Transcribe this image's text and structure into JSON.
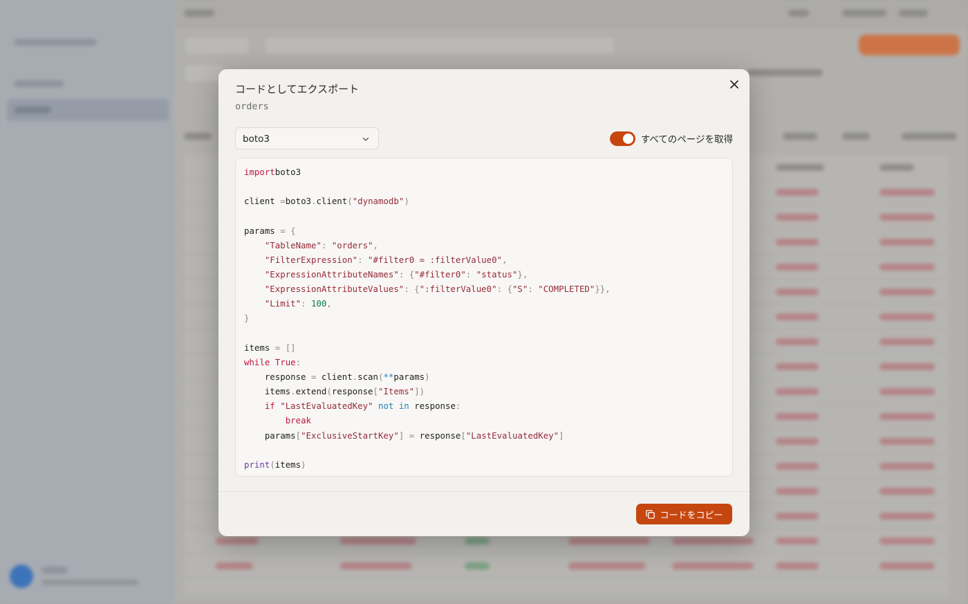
{
  "modal": {
    "title": "コードとしてエクスポート",
    "subtitle": "orders",
    "language_select": {
      "selected": "boto3"
    },
    "fetch_all_pages": {
      "label": "すべてのページを取得",
      "enabled": true
    },
    "copy_button_label": "コードをコピー",
    "accent_color": "#c6460f"
  },
  "code_lines": [
    [
      [
        "kw",
        "import"
      ],
      [
        "",
        "boto3"
      ]
    ],
    [],
    [
      [
        "",
        "client "
      ],
      [
        "op",
        "="
      ],
      [
        "",
        "boto3"
      ],
      [
        "op",
        "."
      ],
      [
        "",
        "client"
      ],
      [
        "op",
        "("
      ],
      [
        "str",
        "\"dynamodb\""
      ],
      [
        "op",
        ")"
      ]
    ],
    [],
    [
      [
        "",
        "params "
      ],
      [
        "op",
        "="
      ],
      [
        "op",
        " {"
      ]
    ],
    [
      [
        "",
        "    "
      ],
      [
        "str",
        "\"TableName\""
      ],
      [
        "op",
        ": "
      ],
      [
        "str",
        "\"orders\""
      ],
      [
        "op",
        ","
      ]
    ],
    [
      [
        "",
        "    "
      ],
      [
        "str",
        "\"FilterExpression\""
      ],
      [
        "op",
        ": "
      ],
      [
        "str",
        "\"#filter0 = :filterValue0\""
      ],
      [
        "op",
        ","
      ]
    ],
    [
      [
        "",
        "    "
      ],
      [
        "str",
        "\"ExpressionAttributeNames\""
      ],
      [
        "op",
        ": {"
      ],
      [
        "str",
        "\"#filter0\""
      ],
      [
        "op",
        ": "
      ],
      [
        "str",
        "\"status\""
      ],
      [
        "op",
        "},"
      ]
    ],
    [
      [
        "",
        "    "
      ],
      [
        "str",
        "\"ExpressionAttributeValues\""
      ],
      [
        "op",
        ": {"
      ],
      [
        "str",
        "\":filterValue0\""
      ],
      [
        "op",
        ": {"
      ],
      [
        "str",
        "\"S\""
      ],
      [
        "op",
        ": "
      ],
      [
        "str",
        "\"COMPLETED\""
      ],
      [
        "op",
        "}},"
      ]
    ],
    [
      [
        "",
        "    "
      ],
      [
        "str",
        "\"Limit\""
      ],
      [
        "op",
        ": "
      ],
      [
        "num",
        "100"
      ],
      [
        "op",
        ","
      ]
    ],
    [
      [
        "op",
        "}"
      ]
    ],
    [],
    [
      [
        "",
        "items "
      ],
      [
        "op",
        "="
      ],
      [
        "op",
        " []"
      ]
    ],
    [
      [
        "kw",
        "while"
      ],
      [
        "",
        " "
      ],
      [
        "kw",
        "True"
      ],
      [
        "op",
        ":"
      ]
    ],
    [
      [
        "",
        "    response "
      ],
      [
        "op",
        "="
      ],
      [
        "",
        " client"
      ],
      [
        "op",
        "."
      ],
      [
        "",
        "scan"
      ],
      [
        "op",
        "("
      ],
      [
        "kw2",
        "**"
      ],
      [
        "",
        "params"
      ],
      [
        "op",
        ")"
      ]
    ],
    [
      [
        "",
        "    items"
      ],
      [
        "op",
        "."
      ],
      [
        "",
        "extend"
      ],
      [
        "op",
        "("
      ],
      [
        "",
        "response"
      ],
      [
        "op",
        "["
      ],
      [
        "str",
        "\"Items\""
      ],
      [
        "op",
        "])"
      ]
    ],
    [
      [
        "",
        "    "
      ],
      [
        "kw",
        "if"
      ],
      [
        "",
        " "
      ],
      [
        "str",
        "\"LastEvaluatedKey\""
      ],
      [
        "",
        " "
      ],
      [
        "kw2",
        "not"
      ],
      [
        "",
        " "
      ],
      [
        "kw2",
        "in"
      ],
      [
        "",
        " response"
      ],
      [
        "op",
        ":"
      ]
    ],
    [
      [
        "",
        "        "
      ],
      [
        "kw",
        "break"
      ]
    ],
    [
      [
        "",
        "    params"
      ],
      [
        "op",
        "["
      ],
      [
        "str",
        "\"ExclusiveStartKey\""
      ],
      [
        "op",
        "]"
      ],
      [
        "",
        " "
      ],
      [
        "op",
        "="
      ],
      [
        "",
        " response"
      ],
      [
        "op",
        "["
      ],
      [
        "str",
        "\"LastEvaluatedKey\""
      ],
      [
        "op",
        "]"
      ]
    ],
    [],
    [
      [
        "bi",
        "print"
      ],
      [
        "op",
        "("
      ],
      [
        "",
        "items"
      ],
      [
        "op",
        ")"
      ]
    ]
  ]
}
